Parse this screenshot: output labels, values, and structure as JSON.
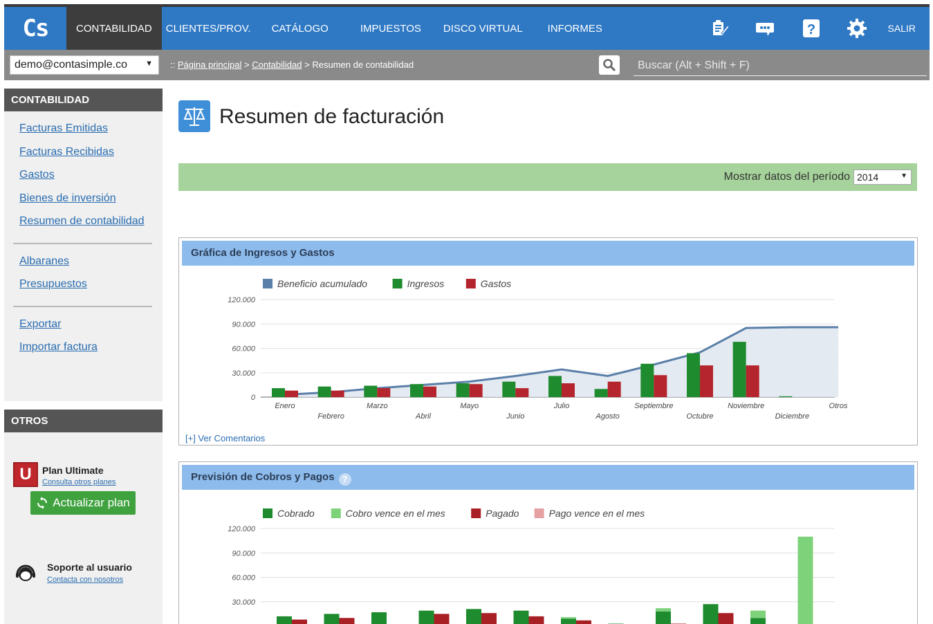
{
  "app": {
    "logo": "Cs",
    "nav": [
      "CONTABILIDAD",
      "CLIENTES/PROV.",
      "CATÁLOGO",
      "IMPUESTOS",
      "DISCO VIRTUAL",
      "INFORMES"
    ],
    "active_nav": "CONTABILIDAD",
    "icons": [
      "notes-edit-icon",
      "chat-icon",
      "help-icon",
      "settings-icon"
    ],
    "logout": "SALIR",
    "brand_color": "#2e78c4"
  },
  "subbar": {
    "account": "demo@contasimple.co",
    "breadcrumb_prefix": "::",
    "crumb_home": "Página principal",
    "crumb_section": "Contabilidad",
    "crumb_current": "Resumen de contabilidad",
    "search_placeholder": "Buscar (Alt + Shift + F)"
  },
  "sidebar": {
    "heading": "CONTABILIDAD",
    "group1": [
      "Facturas Emitidas",
      "Facturas Recibidas",
      "Gastos",
      "Bienes de inversión",
      "Resumen de contabilidad"
    ],
    "group2": [
      "Albaranes",
      "Presupuestos"
    ],
    "group3": [
      "Exportar",
      "Importar factura"
    ],
    "otros_heading": "OTROS",
    "plan_badge": "U",
    "plan_title": "Plan Ultimate",
    "plan_link": "Consulta otros planes",
    "plan_button": "Actualizar plan",
    "support_title": "Soporte al usuario",
    "support_link": "Contacta con nosotros"
  },
  "main": {
    "title": "Resumen de facturación",
    "period_label": "Mostrar datos del período",
    "period_value": "2014",
    "comments_link": "[+] Ver Comentarios"
  },
  "chart_data": [
    {
      "type": "bar",
      "title": "Gráfica de Ingresos y Gastos",
      "categories": [
        "Enero",
        "Febrero",
        "Marzo",
        "Abril",
        "Mayo",
        "Junio",
        "Julio",
        "Agosto",
        "Septiembre",
        "Octubre",
        "Noviembre",
        "Diciembre",
        "Otros"
      ],
      "y_ticks": [
        "120.000",
        "90.000",
        "60.000",
        "30.000",
        "0"
      ],
      "ylim": [
        0,
        120000
      ],
      "legend_position": "top-left",
      "series": [
        {
          "name": "Beneficio acumulado",
          "kind": "area-line",
          "color": "#5a7fa8",
          "values": [
            3000,
            6000,
            11000,
            15000,
            19000,
            26000,
            34000,
            26000,
            40000,
            55000,
            85000,
            86000,
            86000
          ]
        },
        {
          "name": "Ingresos",
          "kind": "bar",
          "color": "#1e8b2e",
          "values": [
            11000,
            13000,
            14000,
            16000,
            17000,
            19000,
            26000,
            10000,
            41000,
            54000,
            68000,
            1000,
            null
          ]
        },
        {
          "name": "Gastos",
          "kind": "bar",
          "color": "#b5252d",
          "values": [
            8000,
            8000,
            11000,
            13000,
            16000,
            11000,
            17000,
            19000,
            27000,
            39000,
            39000,
            null,
            null
          ]
        }
      ]
    },
    {
      "type": "bar",
      "title": "Previsión de Cobros y Pagos",
      "y_ticks": [
        "120.000",
        "90.000",
        "60.000",
        "30.000"
      ],
      "ylim": [
        0,
        120000
      ],
      "legend_position": "top-left",
      "stacked": true,
      "series": [
        {
          "name": "Cobrado",
          "color": "#1e8b2e",
          "values": [
            12000,
            15000,
            17000,
            19000,
            21000,
            19000,
            9000,
            3000,
            18000,
            27000,
            10000,
            0
          ]
        },
        {
          "name": "Cobro vence en el mes",
          "color": "#7dd27a",
          "values": [
            0,
            0,
            0,
            0,
            0,
            0,
            2000,
            0,
            4000,
            0,
            9000,
            110000
          ]
        },
        {
          "name": "Pagado",
          "color": "#a81f24",
          "values": [
            8000,
            10000,
            0,
            15000,
            16000,
            12000,
            7000,
            2000,
            3000,
            16000,
            0,
            0
          ]
        },
        {
          "name": "Pago vence en el mes",
          "color": "#e7a0a2",
          "values": [
            0,
            0,
            0,
            0,
            0,
            0,
            0,
            0,
            0,
            0,
            0,
            0
          ]
        }
      ]
    }
  ]
}
